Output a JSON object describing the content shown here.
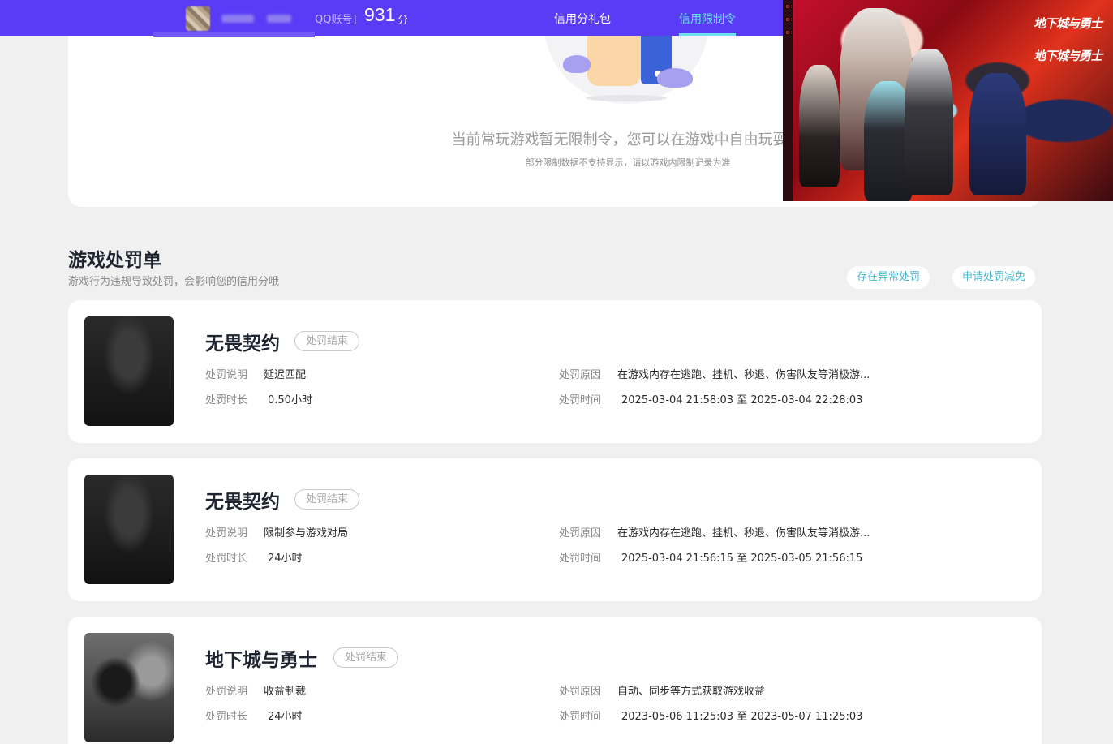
{
  "header": {
    "qq_label": "QQ账号]",
    "score": "931",
    "score_unit": "分",
    "tabs": [
      {
        "label": "信用分礼包",
        "active": false
      },
      {
        "label": "信用限制令",
        "active": true
      }
    ]
  },
  "promo": {
    "logo_text": "地下城与勇士"
  },
  "restriction": {
    "message": "当前常玩游戏暂无限制令，您可以在游戏中自由玩耍 ~",
    "note": "部分限制数据不支持显示，请以游戏内限制记录为准"
  },
  "penalty_section": {
    "title": "游戏处罚单",
    "subtitle": "游戏行为违规导致处罚，会影响您的信用分哦",
    "buttons": {
      "anomaly": "存在异常处罚",
      "reduce": "申请处罚减免"
    }
  },
  "labels": {
    "desc": "处罚说明",
    "duration": "处罚时长",
    "reason": "处罚原因",
    "time": "处罚时间"
  },
  "penalties": [
    {
      "game": "无畏契约",
      "status": "处罚结束",
      "desc": "延迟匹配",
      "duration": "0.50小时",
      "reason": "在游戏内存在逃跑、挂机、秒退、伤害队友等消极游...",
      "time": "2025-03-04 21:58:03 至 2025-03-04 22:28:03"
    },
    {
      "game": "无畏契约",
      "status": "处罚结束",
      "desc": "限制参与游戏对局",
      "duration": "24小时",
      "reason": "在游戏内存在逃跑、挂机、秒退、伤害队友等消极游...",
      "time": "2025-03-04 21:56:15 至 2025-03-05 21:56:15"
    },
    {
      "game": "地下城与勇士",
      "status": "处罚结束",
      "desc": "收益制裁",
      "duration": "24小时",
      "reason": "自动、同步等方式获取游戏收益",
      "time": "2023-05-06 11:25:03 至 2023-05-07 11:25:03"
    }
  ],
  "colors": {
    "topbar": "#5b3cf6",
    "active_tab": "#6ee2ef",
    "button_text": "#46b9d1"
  }
}
